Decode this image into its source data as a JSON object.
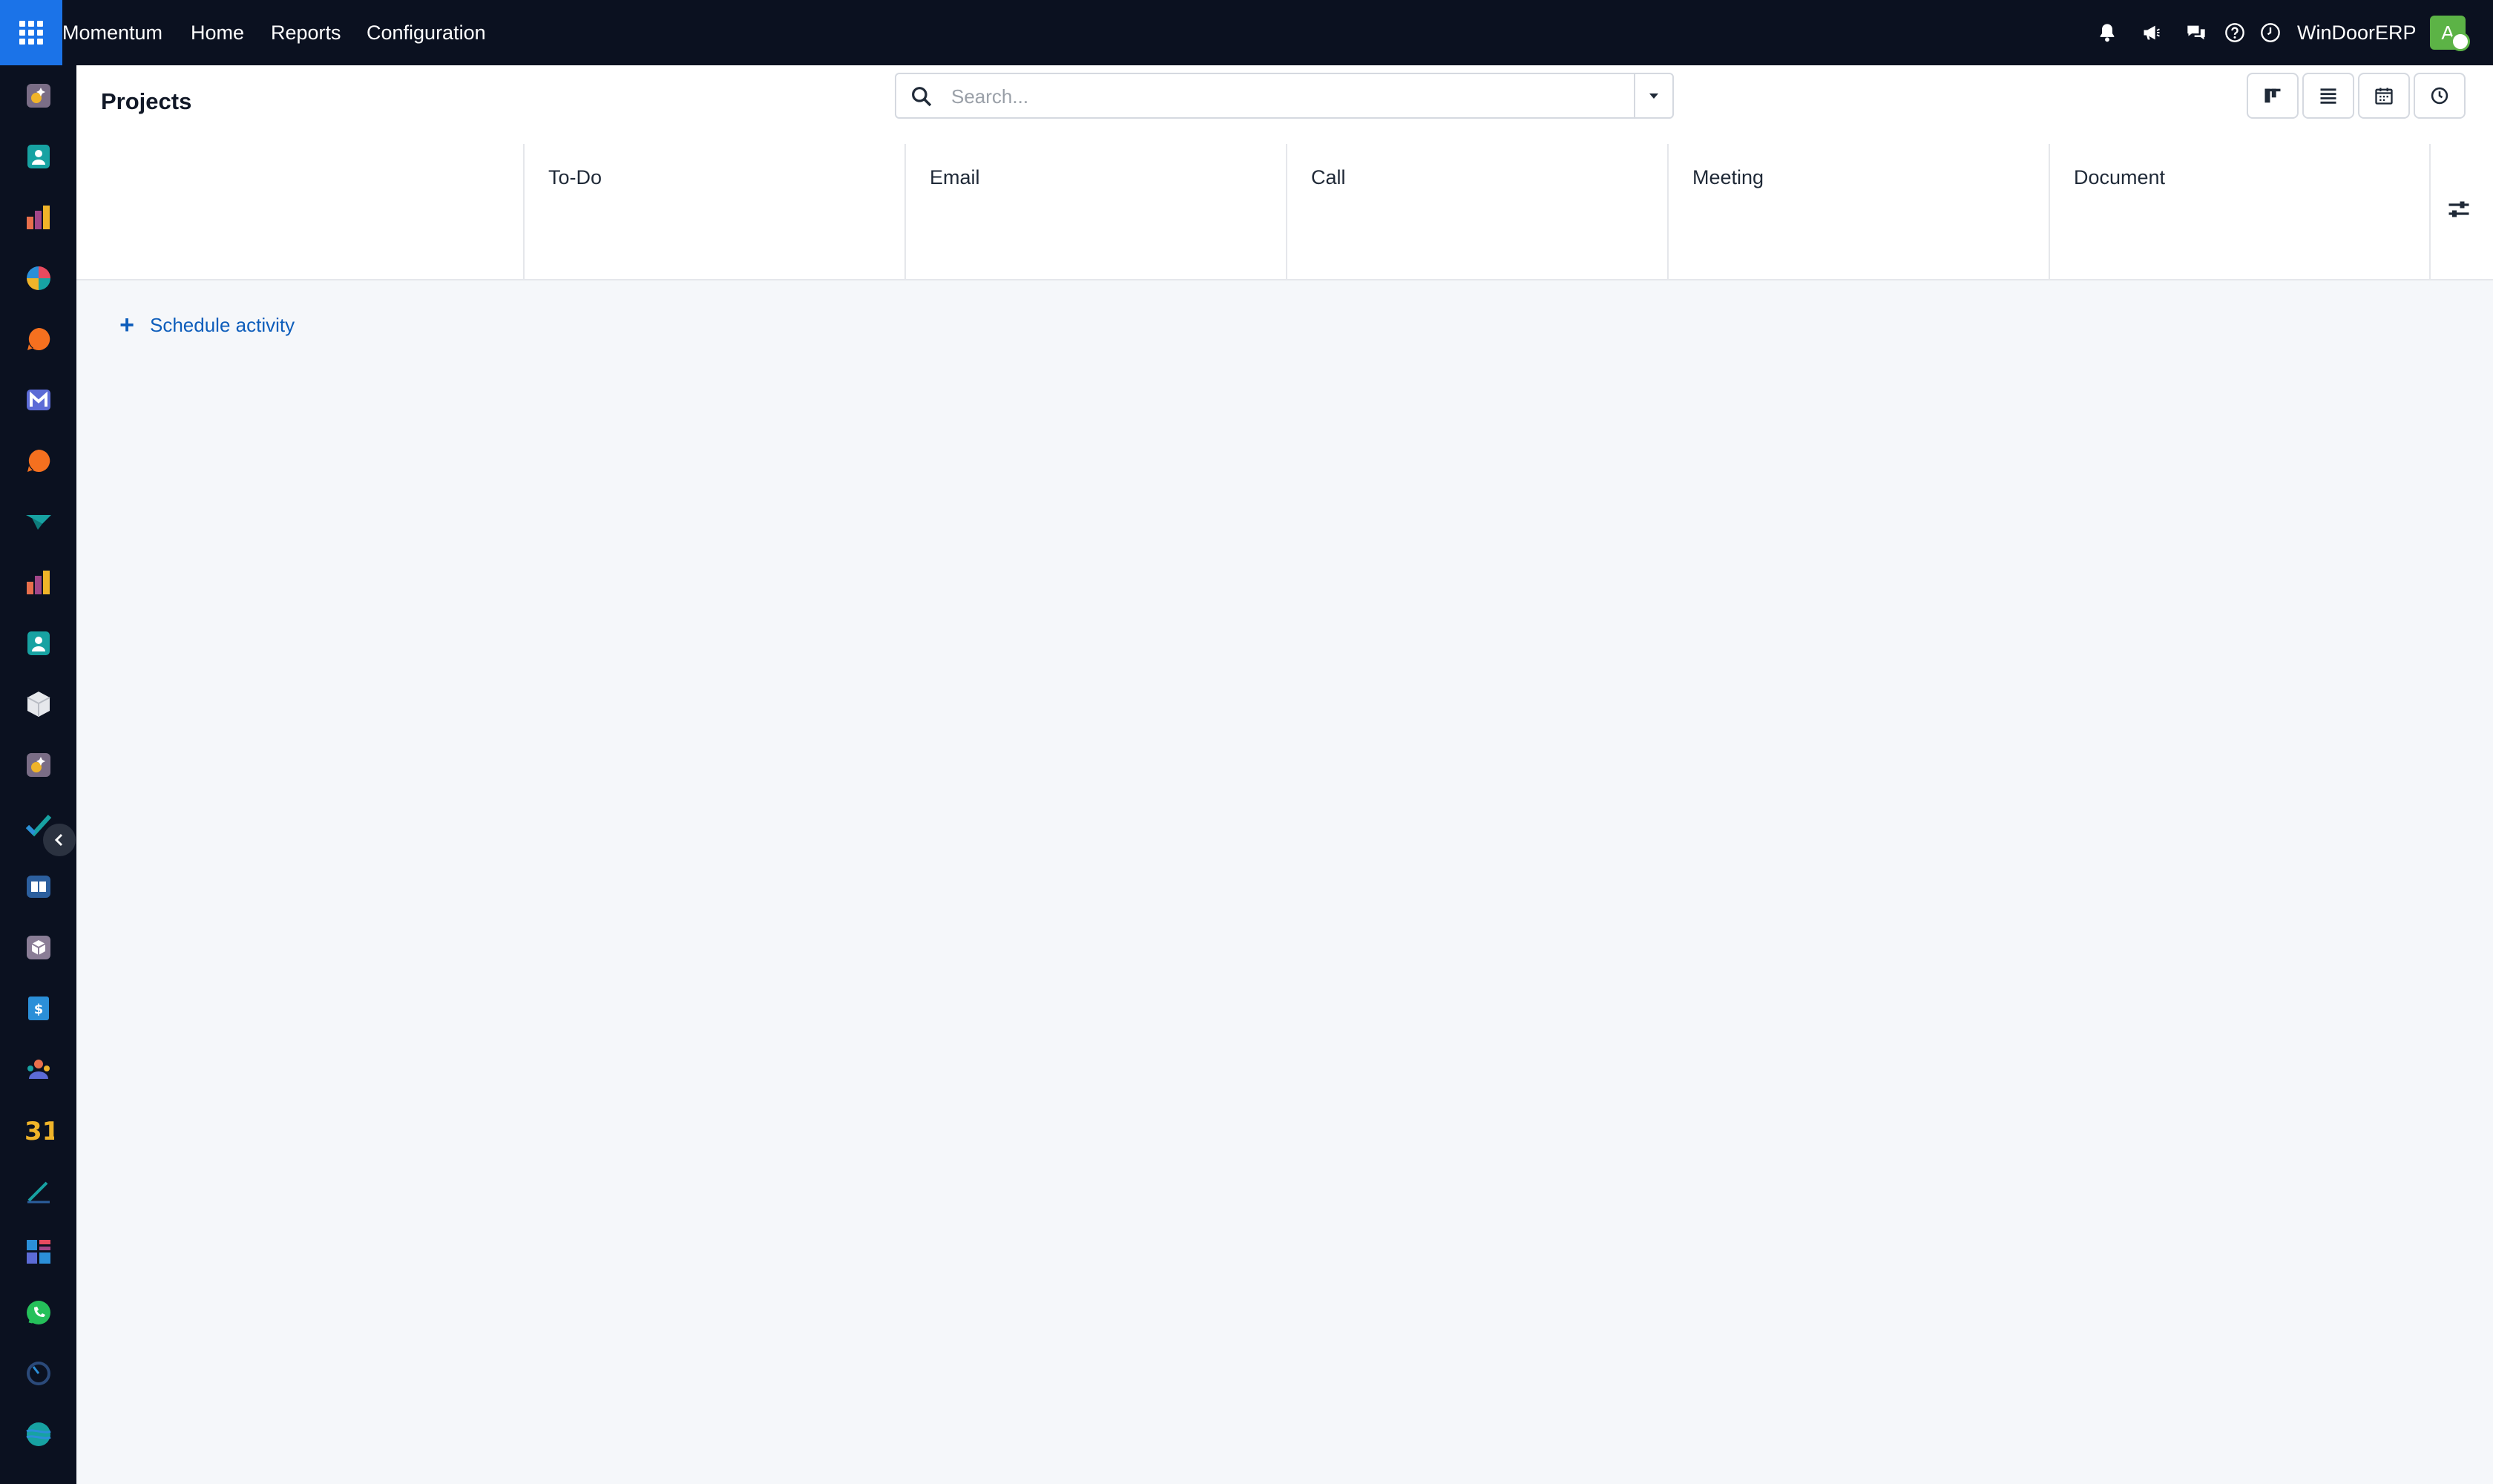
{
  "topbar": {
    "apps_icon": "apps-grid-icon",
    "menu": [
      "Momentum",
      "Home",
      "Reports",
      "Configuration"
    ],
    "icons": [
      "bell-icon",
      "megaphone-icon",
      "chat-icon",
      "help-icon",
      "clock-icon"
    ],
    "company": "WinDoorERP",
    "avatar_letter": "A",
    "avatar_color": "#5cb346"
  },
  "sidebar": {
    "apps": [
      "ai-app-icon",
      "contacts-icon",
      "reports-icon",
      "dashboard-pie-icon",
      "chat-bubble-icon",
      "mail-icon",
      "discuss-icon",
      "sign-icon",
      "analytics-icon",
      "contacts-alt-icon",
      "inventory-icon",
      "ai-app-alt-icon",
      "todo-check-icon",
      "knowledge-icon",
      "package-icon",
      "invoicing-icon",
      "team-icon",
      "calendar-icon",
      "pen-icon",
      "dashboards-icon",
      "whatsapp-icon",
      "timer-icon",
      "website-icon"
    ],
    "collapse_icon": "chevron-left-icon",
    "calendar_day": "31"
  },
  "control_panel": {
    "title": "Projects",
    "search_placeholder": "Search...",
    "views": [
      "kanban-view-icon",
      "list-view-icon",
      "calendar-view-icon",
      "activity-view-icon"
    ]
  },
  "activity_table": {
    "columns": [
      "To-Do",
      "Email",
      "Call",
      "Meeting",
      "Document"
    ],
    "settings_icon": "sliders-icon",
    "schedule_label": "Schedule activity"
  },
  "colors": {
    "navbar": "#0b1120",
    "accent": "#1b73e8",
    "link": "#0d5dbb"
  }
}
